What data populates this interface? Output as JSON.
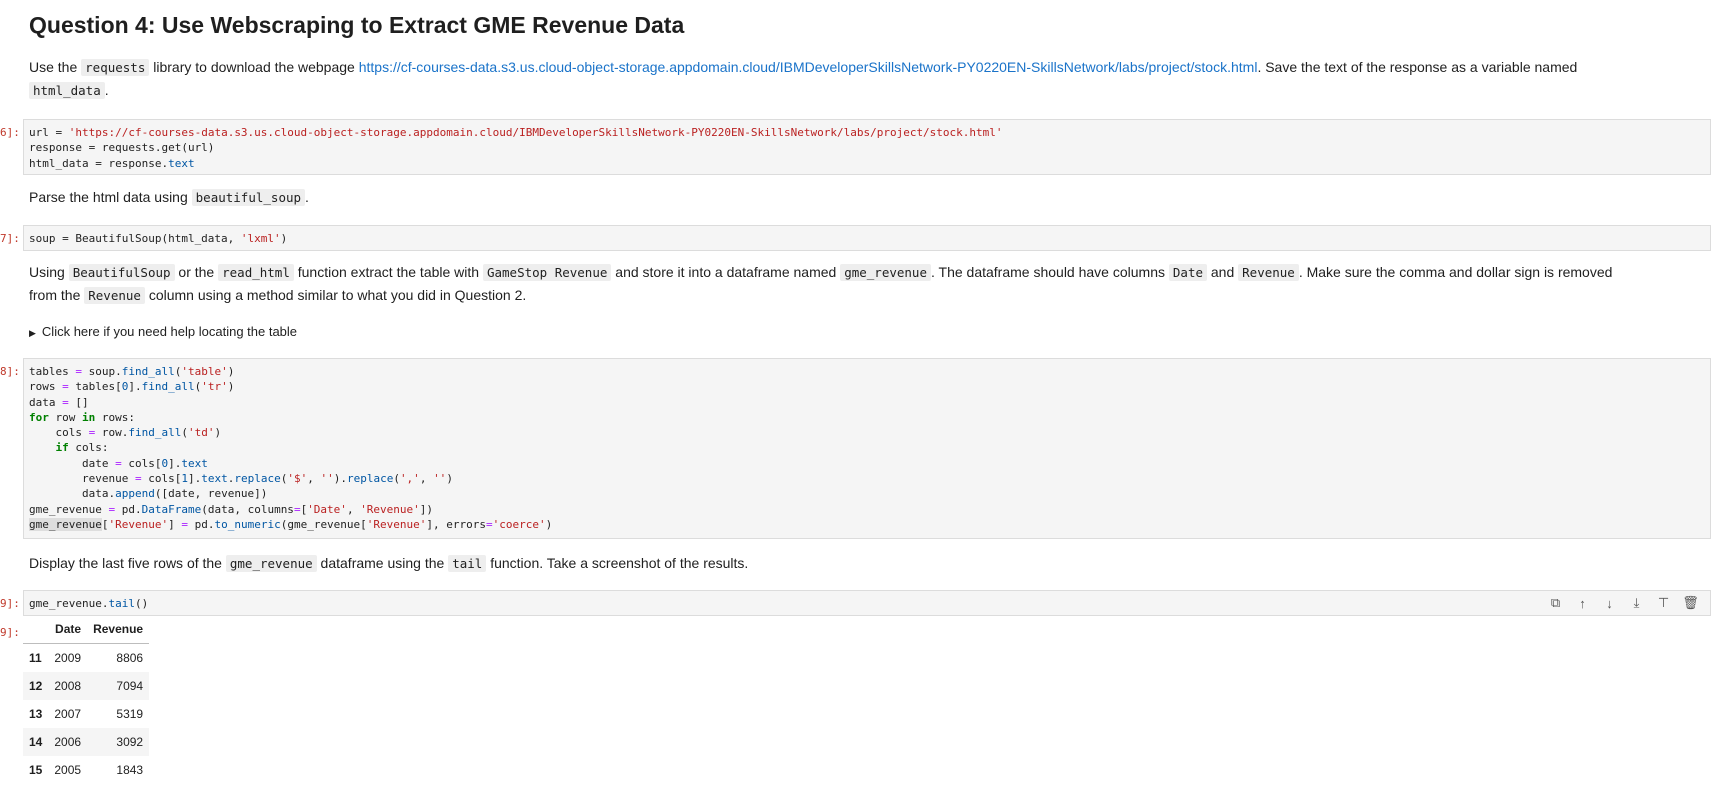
{
  "heading": "Question 4: Use Webscraping to Extract GME Revenue Data",
  "prompts": {
    "cell6": "6]:",
    "cell7": "7]:",
    "cell8": "8]:",
    "cell9_in": "9]:",
    "cell9_out": "9]:"
  },
  "md1": {
    "t1": "Use the ",
    "c1": "requests",
    "t2": " library to download the webpage ",
    "link": "https://cf-courses-data.s3.us.cloud-object-storage.appdomain.cloud/IBMDeveloperSkillsNetwork-PY0220EN-SkillsNetwork/labs/project/stock.html",
    "t3": ". Save the text of the response as a variable named",
    "c2": "html_data",
    "t4": "."
  },
  "code1": {
    "l1a": "url = ",
    "l1s": "'https://cf-courses-data.s3.us.cloud-object-storage.appdomain.cloud/IBMDeveloperSkillsNetwork-PY0220EN-SkillsNetwork/labs/project/stock.html'",
    "l2": "response = requests.get(url)",
    "l3a": "html_data = response.",
    "l3b": "text"
  },
  "md2": {
    "t1": "Parse the html data using ",
    "c1": "beautiful_soup",
    "t2": "."
  },
  "code2": {
    "a": "soup = BeautifulSoup(html_data, ",
    "s": "'lxml'",
    "b": ")"
  },
  "md3": {
    "t1": "Using ",
    "c1": "BeautifulSoup",
    "t2": " or the ",
    "c2": "read_html",
    "t3": " function extract the table with ",
    "c3": "GameStop Revenue",
    "t4": " and store it into a dataframe named ",
    "c4": "gme_revenue",
    "t5": ". The dataframe should have columns ",
    "c5": "Date",
    "t6": " and ",
    "c6": "Revenue",
    "t7": ". Make sure the comma and dollar sign is removed",
    "t8": "from the ",
    "c7": "Revenue",
    "t9": " column using a method similar to what you did in Question 2."
  },
  "details_summary": "Click here if you need help locating the table",
  "md4": {
    "t1": "Display the last five rows of the ",
    "c1": "gme_revenue",
    "t2": " dataframe using the ",
    "c2": "tail",
    "t3": " function. Take a screenshot of the results."
  },
  "code4": {
    "a": "gme_revenue.",
    "b": "tail",
    "c": "()"
  },
  "toolbar_icons": [
    "duplicate-icon",
    "move-up-icon",
    "move-down-icon",
    "insert-above-icon",
    "insert-below-icon",
    "delete-icon"
  ],
  "table": {
    "columns": [
      "Date",
      "Revenue"
    ],
    "rows": [
      {
        "index": "11",
        "date": "2009",
        "revenue": "8806"
      },
      {
        "index": "12",
        "date": "2008",
        "revenue": "7094"
      },
      {
        "index": "13",
        "date": "2007",
        "revenue": "5319"
      },
      {
        "index": "14",
        "date": "2006",
        "revenue": "3092"
      },
      {
        "index": "15",
        "date": "2005",
        "revenue": "1843"
      }
    ]
  }
}
